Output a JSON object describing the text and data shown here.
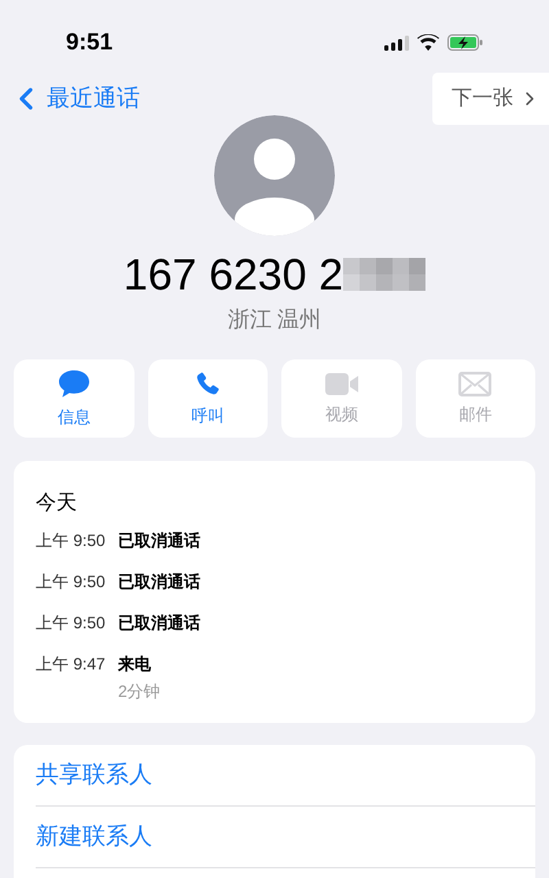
{
  "status_bar": {
    "time": "9:51"
  },
  "nav": {
    "back": "最近通话",
    "next": "下一张"
  },
  "contact": {
    "number": "167 6230 2",
    "location": "浙江 温州"
  },
  "actions": [
    {
      "kind": "message",
      "label": "信息",
      "disabled": false
    },
    {
      "kind": "call",
      "label": "呼叫",
      "disabled": false
    },
    {
      "kind": "video",
      "label": "视频",
      "disabled": true
    },
    {
      "kind": "mail",
      "label": "邮件",
      "disabled": true
    }
  ],
  "history": {
    "heading": "今天",
    "entries": [
      {
        "time": "上午 9:50",
        "type": "已取消通话"
      },
      {
        "time": "上午 9:50",
        "type": "已取消通话"
      },
      {
        "time": "上午 9:50",
        "type": "已取消通话"
      },
      {
        "time": "上午 9:47",
        "type": "来电",
        "duration": "2分钟"
      }
    ]
  },
  "links": [
    "共享联系人",
    "新建联系人"
  ]
}
